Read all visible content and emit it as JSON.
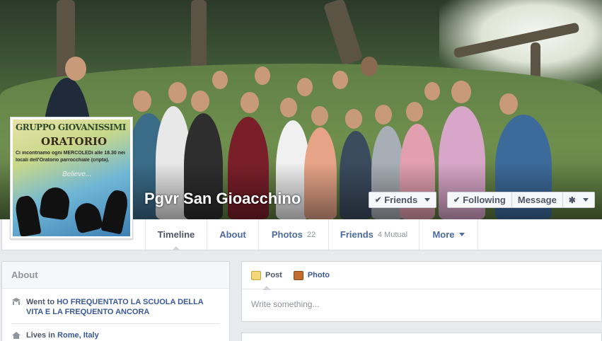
{
  "page": {
    "name": "Pgvr San Gioacchino"
  },
  "cover_actions": {
    "friends_label": "Friends",
    "following_label": "Following",
    "message_label": "Message"
  },
  "profile_picture": {
    "title_line1": "GRUPPO GIOVANISSIMI",
    "title_line2": "ORATORIO",
    "text_line1": "Ci incontriamo ogni MERCOLEDì alle 18.30 nei",
    "text_line2": "locali dell'Oratorio parrocchiale (cripta).",
    "tagline": "Believe..."
  },
  "nav": {
    "tabs": [
      {
        "label": "Timeline",
        "count": ""
      },
      {
        "label": "About",
        "count": ""
      },
      {
        "label": "Photos",
        "count": "22"
      },
      {
        "label": "Friends",
        "count": "4 Mutual"
      },
      {
        "label": "More",
        "count": ""
      }
    ]
  },
  "about": {
    "heading": "About",
    "items": [
      {
        "icon": "education-icon",
        "prefix": "Went to ",
        "value": "HO FREQUENTATO LA SCUOLA DELLA VITA E LA FREQUENTO ANCORA"
      },
      {
        "icon": "home-icon",
        "prefix": "Lives in ",
        "value": "Rome, Italy"
      }
    ]
  },
  "composer": {
    "tabs": [
      {
        "icon": "post-icon",
        "label": "Post"
      },
      {
        "icon": "photo-icon",
        "label": "Photo"
      }
    ],
    "placeholder": "Write something..."
  },
  "colors": {
    "link": "#3b5998",
    "text": "#4e5665",
    "muted": "#90949c",
    "background": "#e9eaed"
  }
}
